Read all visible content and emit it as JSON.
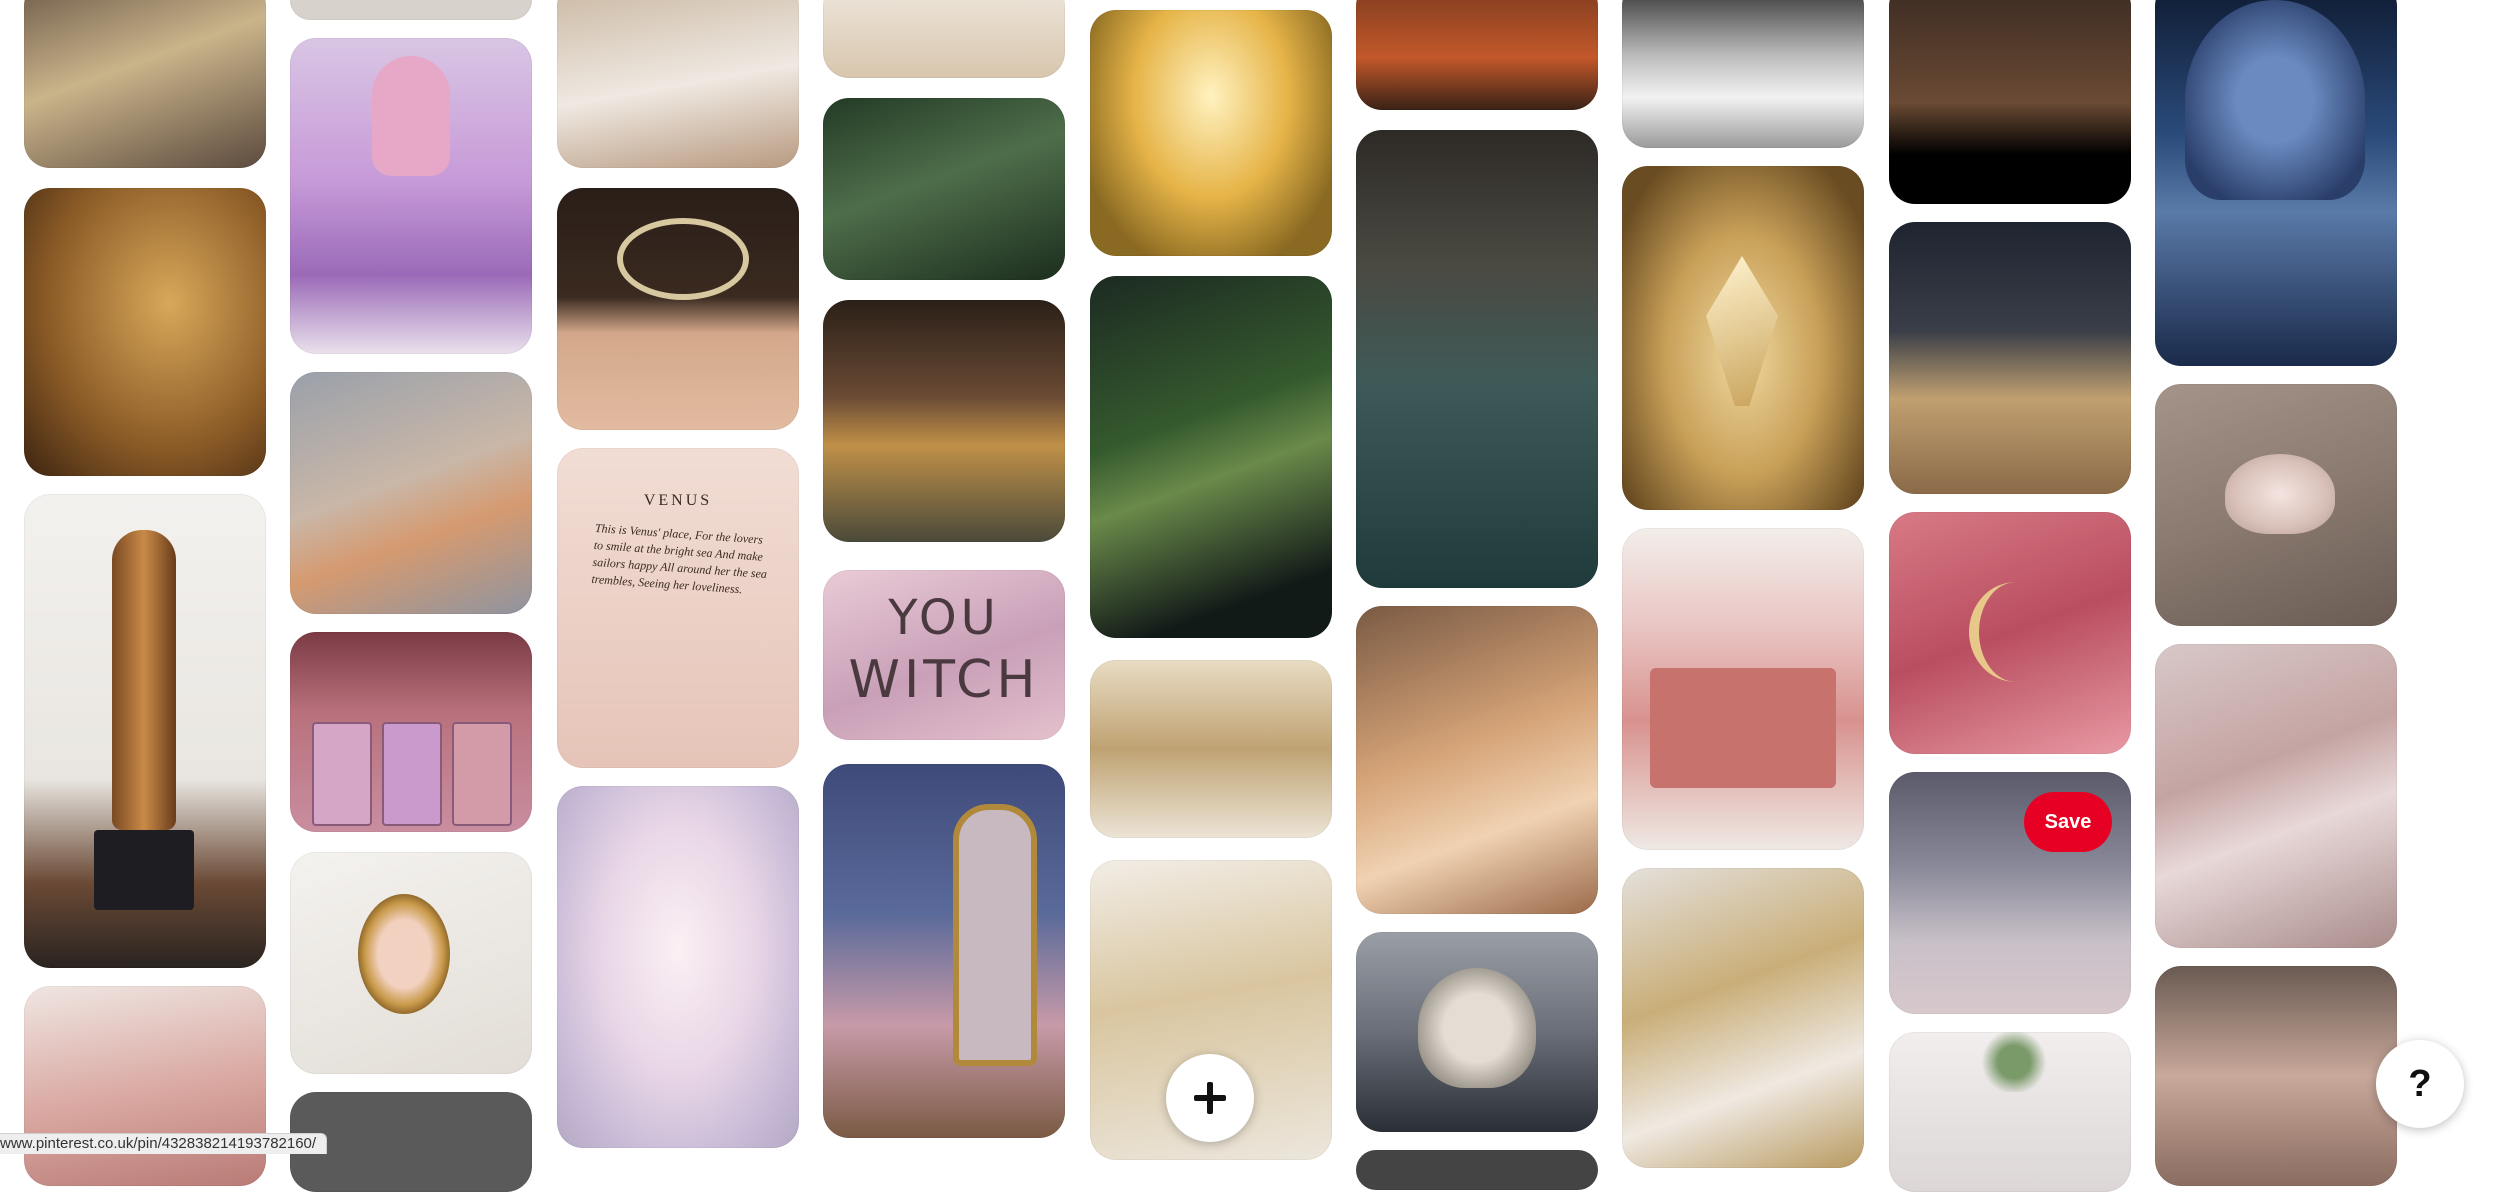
{
  "page": {
    "save_label": "Save",
    "help_label": "?",
    "status_url": "www.pinterest.co.uk/pin/432838214193782160/"
  },
  "icons": {
    "plus": "plus-icon",
    "help": "help-icon"
  },
  "pin_images": {
    "book_page_heading": "VENUS",
    "book_page_text": "This is Venus' place, For the lovers to smile at the bright sea And make sailors happy All around her the sea trembles, Seeing her loveliness.",
    "you_witch_line1": "YOU",
    "you_witch_line2": "WITCH"
  },
  "colors": {
    "save_button": "#e60023",
    "background": "#ffffff"
  }
}
